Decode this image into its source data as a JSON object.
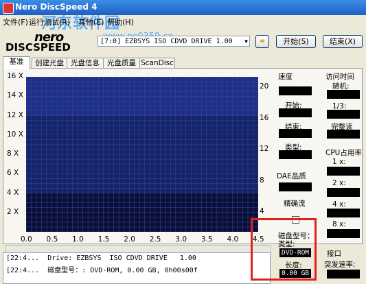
{
  "window": {
    "title": "Nero DiscSpeed 4"
  },
  "watermark": {
    "text": "河东软件园",
    "url": "www.pc0359.cn"
  },
  "menu": [
    "文件(F)",
    "运行测试(R)",
    "其他(E)",
    "帮助(H)"
  ],
  "logo": {
    "line1": "nero",
    "line2": "DISCSPEED"
  },
  "drive": {
    "value": "[7:0] EZBSYS ISO CDVD DRIVE 1.00"
  },
  "buttons": {
    "start": "开始(S)",
    "end": "结束(X)"
  },
  "tabs": [
    "基准",
    "创建光盘",
    "光盘信息",
    "光盘质量",
    "ScanDisc"
  ],
  "chart_data": {
    "type": "line",
    "x_ticks": [
      "0.0",
      "0.5",
      "1.0",
      "1.5",
      "2.0",
      "2.5",
      "3.0",
      "3.5",
      "4.0",
      "4.5"
    ],
    "y_left_ticks": [
      "16 X",
      "14 X",
      "12 X",
      "10 X",
      "8 X",
      "6 X",
      "4 X",
      "2 X"
    ],
    "y_right_ticks": [
      "20",
      "16",
      "12",
      "8",
      "4"
    ],
    "xlim": [
      0,
      4.5
    ],
    "ylim_left": [
      0,
      16
    ],
    "ylim_right": [
      0,
      20
    ],
    "grid": true,
    "series": []
  },
  "log": [
    "[22:4...  Drive: EZBSYS  ISO CDVD DRIVE   1.00",
    "[22:4...  磁盘型号：: DVD-ROM, 0.00 GB, 0h00s00f"
  ],
  "right": {
    "speed_title": "速度",
    "start_label": "开始:",
    "end_label": "结束:",
    "type_label": "类型:",
    "dae_title": "DAE品质",
    "accurate_label": "精确流",
    "access_title": "访问时间",
    "random_label": "随机:",
    "third_label": "1/3:",
    "full_label": "完整读",
    "cpu_title": "CPU占用率",
    "cpu_1x": "1 x:",
    "cpu_2x": "2 x:",
    "cpu_4x": "4 x:",
    "cpu_8x": "8 x:",
    "disc_type_label": "磁盘型号：类型:",
    "disc_type_value": "DVD-ROM",
    "length_label": "长度:",
    "length_value": "0.00 GB",
    "interface_title": "接口",
    "burst_label": "突发速率:"
  }
}
